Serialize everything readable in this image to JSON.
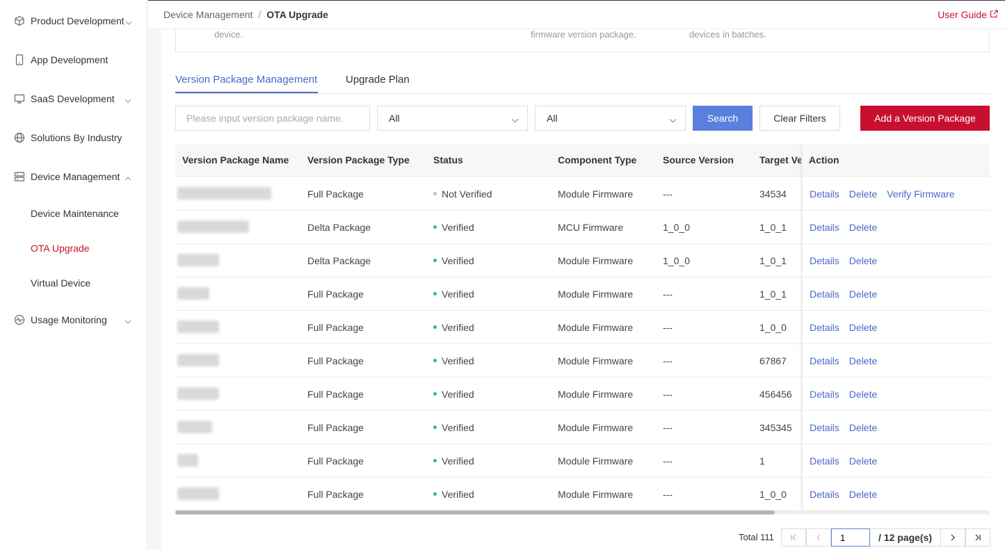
{
  "sidebar": {
    "items": [
      {
        "label": "Product Development",
        "icon": "cube-icon"
      },
      {
        "label": "App Development",
        "icon": "phone-icon"
      },
      {
        "label": "SaaS Development",
        "icon": "monitor-icon"
      },
      {
        "label": "Solutions By Industry",
        "icon": "globe-icon"
      },
      {
        "label": "Device Management",
        "icon": "server-icon"
      },
      {
        "label": "Usage Monitoring",
        "icon": "pulse-icon"
      }
    ],
    "sub_items": [
      "Device Maintenance",
      "OTA Upgrade",
      "Virtual Device"
    ],
    "active_sub": "OTA Upgrade"
  },
  "header": {
    "breadcrumb": [
      "Device Management",
      "OTA Upgrade"
    ],
    "separator": "/",
    "user_guide": "User Guide"
  },
  "intro": {
    "snippets": [
      "device.",
      "firmware version package.",
      "devices in batches."
    ]
  },
  "tabs": [
    "Version Package Management",
    "Upgrade Plan"
  ],
  "filters": {
    "search_placeholder": "Please input version package name.",
    "type_value": "All",
    "status_value": "All",
    "search_label": "Search",
    "clear_label": "Clear Filters",
    "add_label": "Add a Version Package"
  },
  "table": {
    "headers": [
      "Version Package Name",
      "Version Package Type",
      "Status",
      "Component Type",
      "Source Version",
      "Target Version",
      "Action"
    ],
    "rows": [
      {
        "type": "Full Package",
        "status": "Not Verified",
        "component": "Module Firmware",
        "source": "---",
        "target": "34534",
        "actions": [
          "Details",
          "Delete",
          "Verify Firmware"
        ]
      },
      {
        "type": "Delta Package",
        "status": "Verified",
        "component": "MCU Firmware",
        "source": "1_0_0",
        "target": "1_0_1",
        "actions": [
          "Details",
          "Delete"
        ]
      },
      {
        "type": "Delta Package",
        "status": "Verified",
        "component": "Module Firmware",
        "source": "1_0_0",
        "target": "1_0_1",
        "actions": [
          "Details",
          "Delete"
        ]
      },
      {
        "type": "Full Package",
        "status": "Verified",
        "component": "Module Firmware",
        "source": "---",
        "target": "1_0_1",
        "actions": [
          "Details",
          "Delete"
        ]
      },
      {
        "type": "Full Package",
        "status": "Verified",
        "component": "Module Firmware",
        "source": "---",
        "target": "1_0_0",
        "actions": [
          "Details",
          "Delete"
        ]
      },
      {
        "type": "Full Package",
        "status": "Verified",
        "component": "Module Firmware",
        "source": "---",
        "target": "67867",
        "actions": [
          "Details",
          "Delete"
        ]
      },
      {
        "type": "Full Package",
        "status": "Verified",
        "component": "Module Firmware",
        "source": "---",
        "target": "456456",
        "actions": [
          "Details",
          "Delete"
        ]
      },
      {
        "type": "Full Package",
        "status": "Verified",
        "component": "Module Firmware",
        "source": "---",
        "target": "345345",
        "actions": [
          "Details",
          "Delete"
        ]
      },
      {
        "type": "Full Package",
        "status": "Verified",
        "component": "Module Firmware",
        "source": "---",
        "target": "1",
        "actions": [
          "Details",
          "Delete"
        ]
      },
      {
        "type": "Full Package",
        "status": "Verified",
        "component": "Module Firmware",
        "source": "---",
        "target": "1_0_0",
        "actions": [
          "Details",
          "Delete"
        ]
      }
    ]
  },
  "pagination": {
    "total_label": "Total 111",
    "current_page": "1",
    "pages_label": "/ 12 page(s)"
  },
  "colors": {
    "accent": "#4a67c9",
    "brand_red": "#c8102e",
    "verified": "#1fbf8f",
    "not_verified": "#bfbfbf"
  }
}
